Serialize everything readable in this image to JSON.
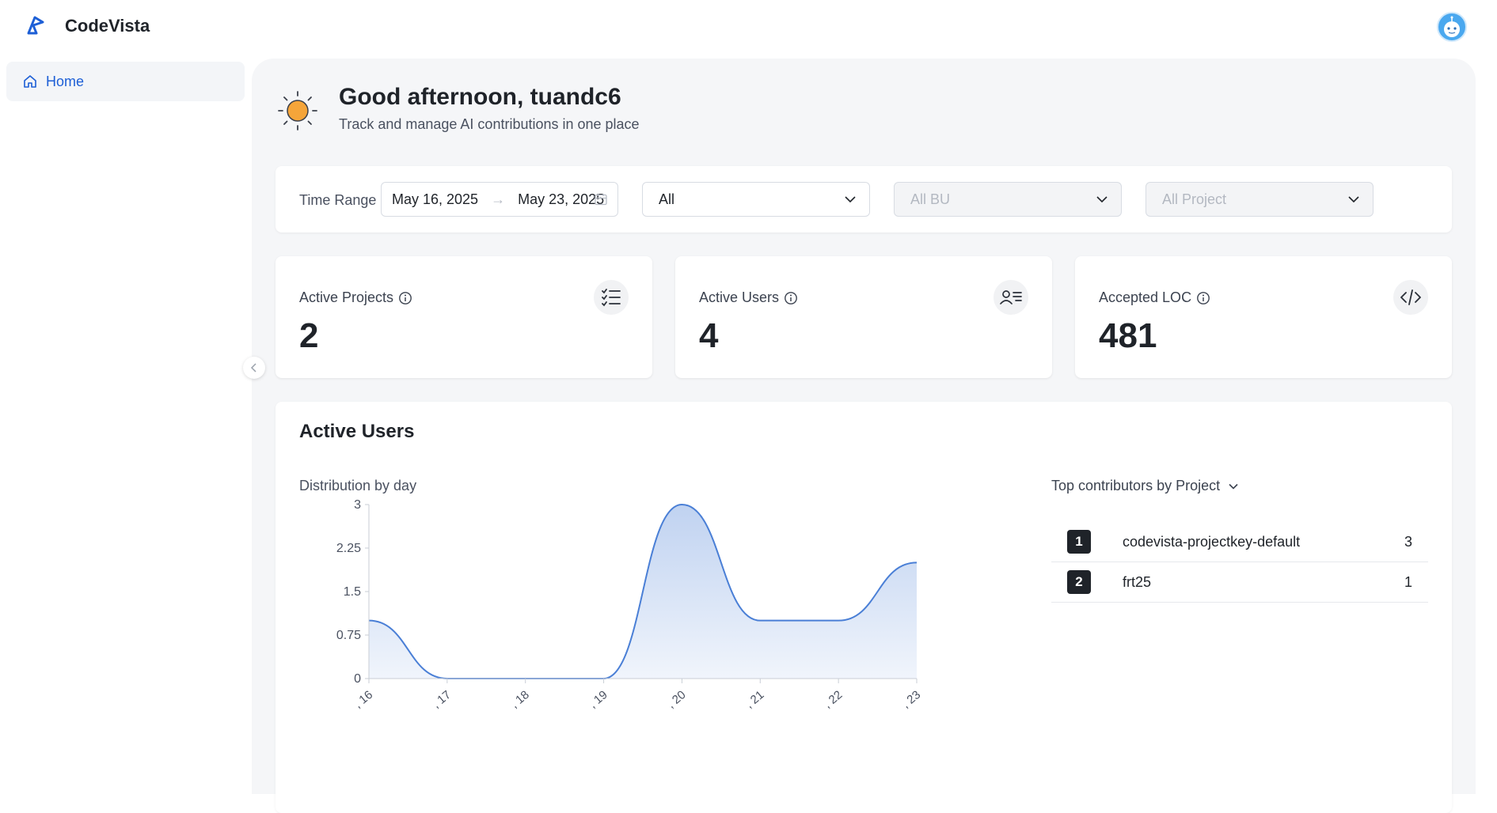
{
  "app": {
    "brand": "CodeVista"
  },
  "sidebar": {
    "items": [
      {
        "label": "Home",
        "icon": "home-icon"
      }
    ]
  },
  "greeting": {
    "title": "Good afternoon, tuandc6",
    "subtitle": "Track and manage AI contributions in one place"
  },
  "filters": {
    "time_range_label": "Time Range",
    "start_date": "May 16, 2025",
    "end_date": "May 23, 2025",
    "select_all": "All",
    "select_bu": "All BU",
    "select_project": "All Project"
  },
  "stats": [
    {
      "label": "Active Projects",
      "value": "2",
      "icon": "checklist-icon"
    },
    {
      "label": "Active Users",
      "value": "4",
      "icon": "user-list-icon"
    },
    {
      "label": "Accepted LOC",
      "value": "481",
      "icon": "code-icon"
    }
  ],
  "active_users": {
    "title": "Active Users",
    "subtitle": "Distribution by day",
    "contributors_heading": "Top contributors by Project",
    "contributors": [
      {
        "rank": "1",
        "name": "codevista-projectkey-default",
        "count": "3"
      },
      {
        "rank": "2",
        "name": "frt25",
        "count": "1"
      }
    ]
  },
  "chart_data": {
    "type": "area",
    "x": [
      ", 16",
      ", 17",
      ", 18",
      ", 19",
      ", 20",
      ", 21",
      ", 22",
      ", 23"
    ],
    "values": [
      1,
      0,
      0,
      0,
      3,
      1,
      1,
      2
    ],
    "ylim": [
      0,
      3
    ],
    "yticks": [
      "0",
      "0.75",
      "1.5",
      "2.25",
      "3"
    ],
    "grid": false,
    "color": "#4a7fd6"
  },
  "colors": {
    "accent": "#1d5fd6",
    "sun": "#f5a53a"
  }
}
